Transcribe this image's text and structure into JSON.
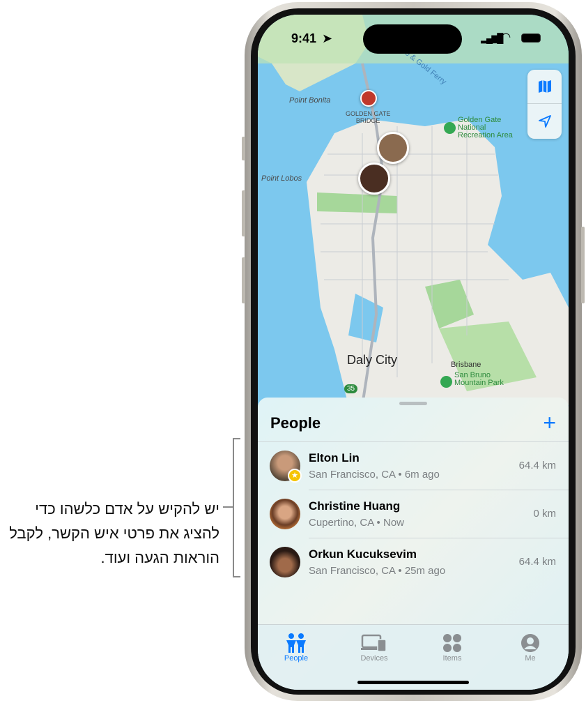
{
  "callout": {
    "text": "יש להקיש על אדם כלשהו כדי להציג את פרטי איש הקשר, לקבל הוראות הגעה ועוד."
  },
  "status": {
    "time": "9:41"
  },
  "map": {
    "labels": {
      "point_bonita": "Point Bonita",
      "golden_gate_bridge_1": "GOLDEN GATE",
      "golden_gate_bridge_2": "BRIDGE",
      "ggnra_1": "Golden Gate",
      "ggnra_2": "National",
      "ggnra_3": "Recreation Area",
      "point_lobos": "Point Lobos",
      "daly_city": "Daly City",
      "brisbane": "Brisbane",
      "san_bruno_1": "San Bruno",
      "san_bruno_2": "Mountain Park",
      "ferry": "e & Gold Ferry",
      "highway": "35"
    },
    "controls": [
      "map-icon",
      "location-arrow-icon"
    ]
  },
  "sheet": {
    "title": "People",
    "add_icon": "plus-icon",
    "people": [
      {
        "name": "Elton Lin",
        "location": "San Francisco, CA",
        "time": "6m ago",
        "distance": "64.4 km",
        "favorite": true
      },
      {
        "name": "Christine Huang",
        "location": "Cupertino, CA",
        "time": "Now",
        "distance": "0 km",
        "favorite": false
      },
      {
        "name": "Orkun Kucuksevim",
        "location": "San Francisco, CA",
        "time": "25m ago",
        "distance": "64.4 km",
        "favorite": false
      }
    ],
    "separator": " • "
  },
  "tabs": [
    {
      "label": "People",
      "active": true
    },
    {
      "label": "Devices"
    },
    {
      "label": "Items"
    },
    {
      "label": "Me"
    }
  ],
  "colors": {
    "accent": "#0a7aff",
    "water": "#7cc8ee",
    "favorite": "#f5c400"
  }
}
